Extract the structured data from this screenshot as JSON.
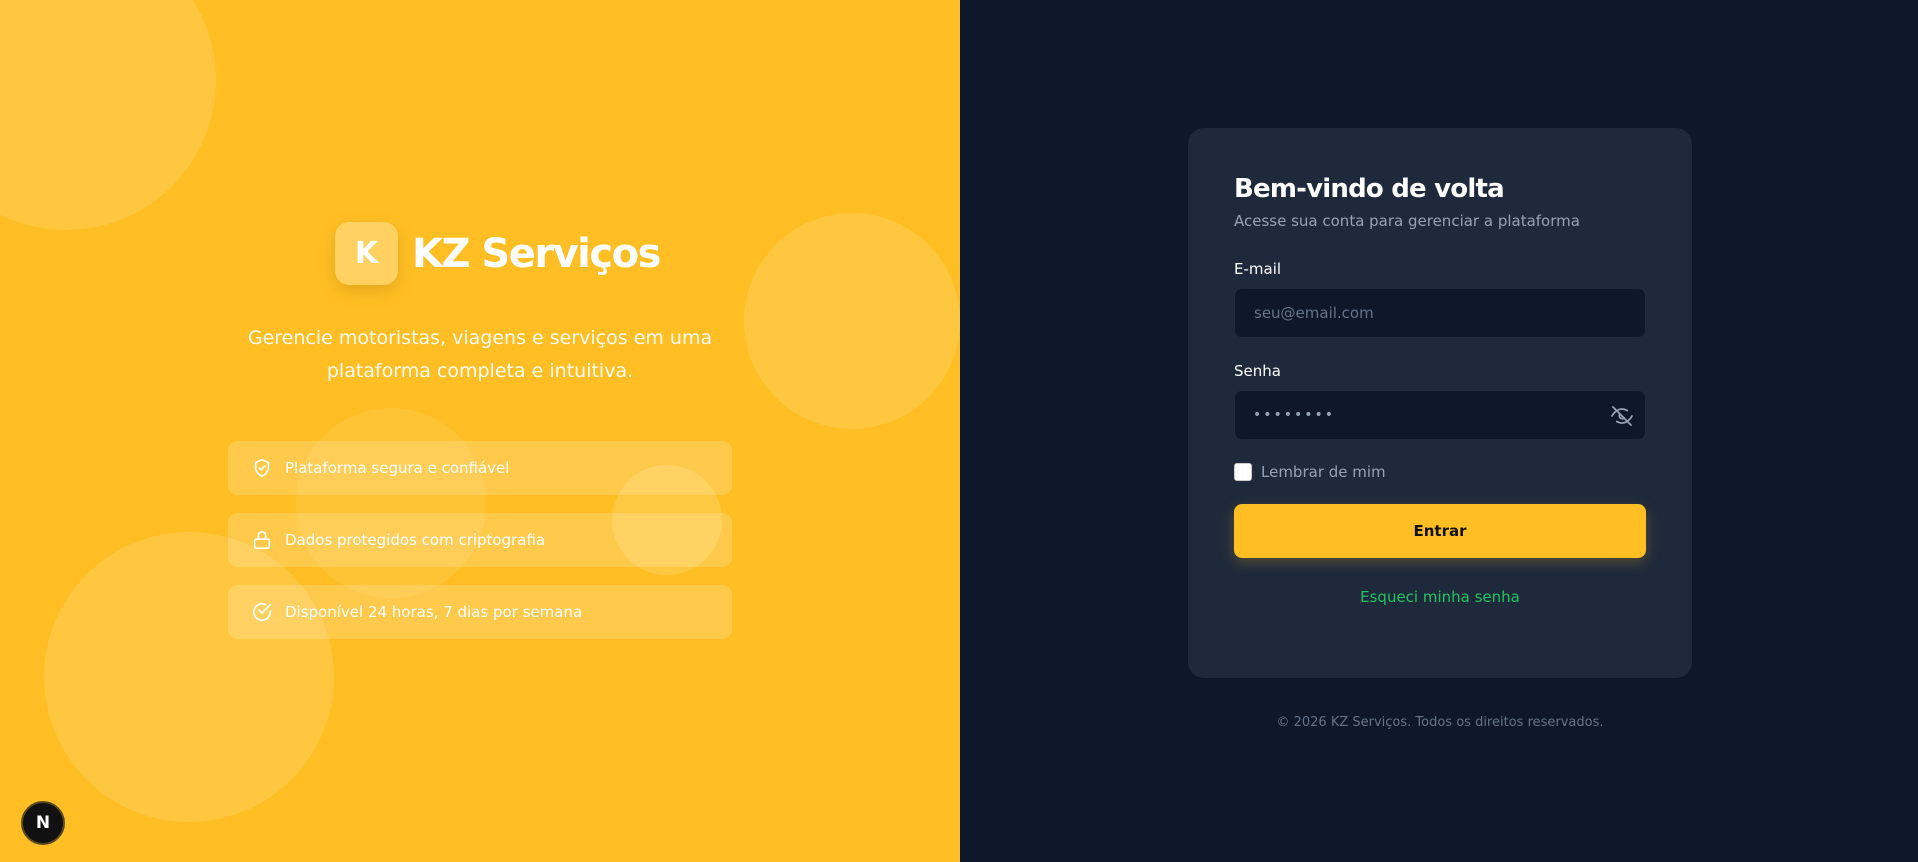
{
  "brand": {
    "logo_letter": "K",
    "name": "KZ Serviços",
    "tagline": "Gerencie motoristas, viagens e serviços em uma plataforma completa e intuitiva.",
    "color": "#FFBF24"
  },
  "features": [
    {
      "icon": "shield-check-icon",
      "label": "Plataforma segura e confiável"
    },
    {
      "icon": "lock-icon",
      "label": "Dados protegidos com criptografia"
    },
    {
      "icon": "check-circle-icon",
      "label": "Disponível 24 horas, 7 dias por semana"
    }
  ],
  "badge": {
    "letter": "N"
  },
  "login": {
    "title": "Bem-vindo de volta",
    "subtitle": "Acesse sua conta para gerenciar a plataforma",
    "email_label": "E-mail",
    "email_placeholder": "seu@email.com",
    "email_value": "",
    "password_label": "Senha",
    "password_mask": "••••••••",
    "remember_label": "Lembrar de mim",
    "remember_checked": false,
    "submit_label": "Entrar",
    "forgot_label": "Esqueci minha senha"
  },
  "footer": {
    "text": "© 2026 KZ Serviços. Todos os direitos reservados."
  },
  "colors": {
    "dark_bg": "#0F172A",
    "card_bg": "#1E293B",
    "link": "#22C55E"
  }
}
